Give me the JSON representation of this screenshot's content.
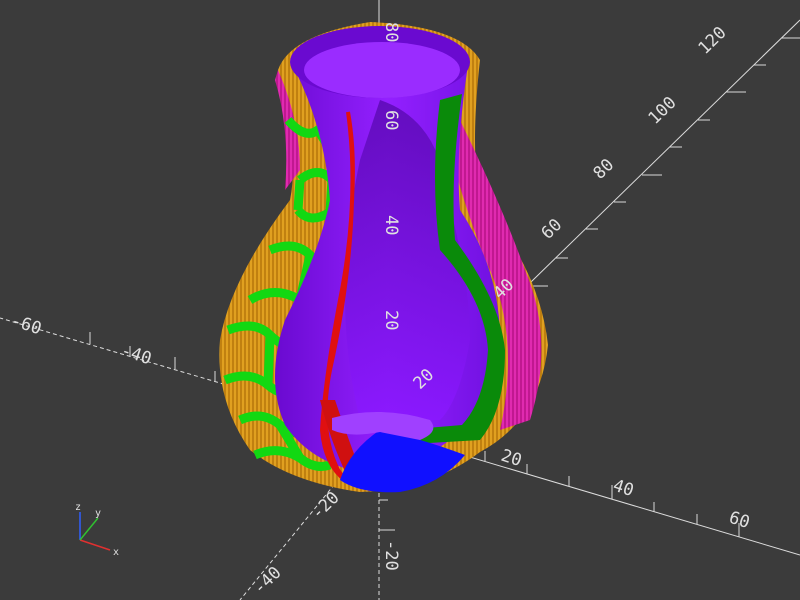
{
  "viewport": {
    "background": "#3b3b3b",
    "axis_color": "#dcdcdc",
    "tick_color": "#d8d8d8"
  },
  "axis_labels": {
    "z_80": "80",
    "z_60": "60",
    "z_40": "40",
    "z_20": "20",
    "z_neg20": "-20",
    "x_neg60": "-60",
    "x_neg40": "-40",
    "x_20": "20",
    "x_40": "40",
    "x_60": "60",
    "y_20": "20",
    "y_40": "40",
    "y_60": "60",
    "y_80": "80",
    "y_100": "100",
    "y_120": "120",
    "y_neg20": "-20",
    "y_neg40": "-40"
  },
  "axes_gizmo": {
    "x_label": "x",
    "y_label": "y",
    "z_label": "z",
    "x_color": "#e03030",
    "y_color": "#30c030",
    "z_color": "#3060ff"
  },
  "model": {
    "name": "vase-cutaway",
    "colors": {
      "surface": "#8a18ff",
      "surface_dark": "#5c0ab4",
      "cut_face": "#e01010",
      "inner_green": "#0a8a0a",
      "lattice_green": "#12d812",
      "lattice_orange": "#e0a020",
      "lattice_magenta": "#e02ab0",
      "base_blue": "#1010ff"
    }
  }
}
